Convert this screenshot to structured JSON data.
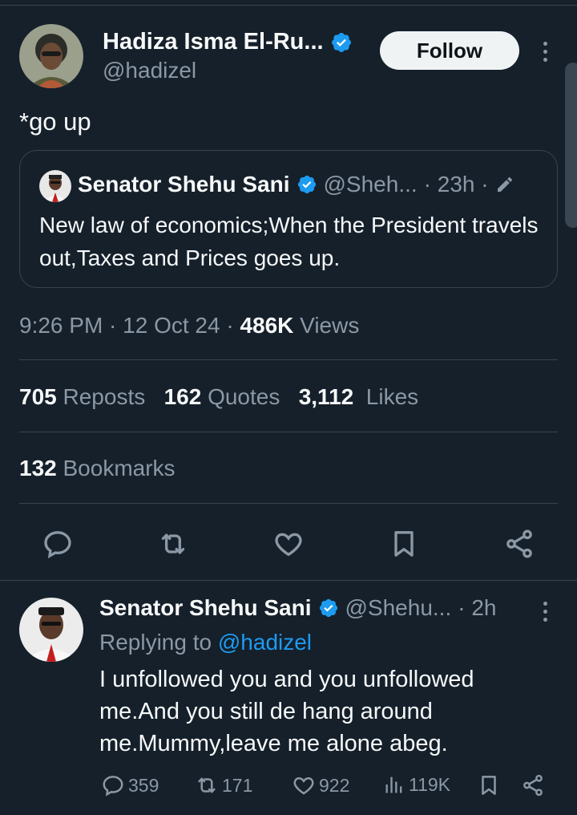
{
  "tweet": {
    "author_name": "Hadiza Isma El-Ru...",
    "author_handle": "@hadizel",
    "follow_label": "Follow",
    "text": "*go up",
    "time": "9:26 PM · 12 Oct 24 · ",
    "views_count": "486K",
    "views_label": " Views"
  },
  "quote": {
    "author_name": "Senator Shehu Sani",
    "author_handle": "@Sheh...",
    "age": "· 23h ·",
    "text": "New law of economics;When the President travels out,Taxes and Prices goes up."
  },
  "stats": {
    "reposts_count": "705",
    "reposts_label": "Reposts",
    "quotes_count": "162",
    "quotes_label": "Quotes",
    "likes_count": "3,112",
    "likes_label": "Likes",
    "bookmarks_count": "132",
    "bookmarks_label": "Bookmarks"
  },
  "reply": {
    "author_name": "Senator Shehu Sani",
    "author_handle": "@Shehu...",
    "age": "· 2h",
    "replying_prefix": "Replying to ",
    "replying_to": "@hadizel",
    "text": "I unfollowed you and you unfollowed me.And you still de hang around me.Mummy,leave me alone abeg.",
    "replies": "359",
    "reposts": "171",
    "likes": "922",
    "views": "119K"
  },
  "colors": {
    "background": "#15202b",
    "verified": "#1d9bf0",
    "muted": "#8b98a5",
    "border": "#38444d"
  },
  "icons": [
    "verified-icon",
    "more-icon",
    "edit-icon",
    "reply-icon",
    "repost-icon",
    "like-icon",
    "bookmark-icon",
    "share-icon",
    "views-icon"
  ]
}
